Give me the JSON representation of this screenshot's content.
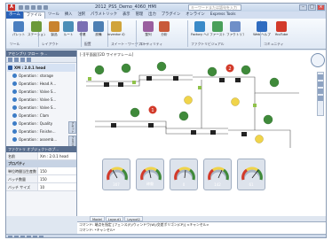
{
  "app": {
    "logo_text": "A",
    "title": "2012_PSS_Demo_4060_HMI",
    "search_placeholder": "キーワードまたは語句を入力"
  },
  "ribbon_tabs": [
    "ホーム",
    "ファイル",
    "ツール",
    "挿入",
    "注釈",
    "パラメトリック",
    "表示",
    "管理",
    "出力",
    "プラグイン",
    "オンライン",
    "Express Tools"
  ],
  "ribbon_buttons": [
    {
      "label": "パレット",
      "icon": "palette-icon",
      "color": "#4a7fc0"
    },
    {
      "label": "ステーション",
      "icon": "station-icon",
      "color": "#6c9a3a"
    },
    {
      "label": "製品",
      "icon": "product-icon",
      "color": "#c8832e"
    },
    {
      "label": "ルート",
      "icon": "route-icon",
      "color": "#4b8fb8"
    },
    {
      "label": "作業",
      "icon": "operation-icon",
      "color": "#7a6fb3"
    },
    {
      "label": "設備",
      "icon": "equipment-icon",
      "color": "#4d7fb3"
    },
    {
      "label": "Inventor の注記",
      "icon": "inventor-icon",
      "color": "#d0a43a"
    },
    {
      "label": "整列",
      "icon": "align-icon",
      "color": "#9a5f9f"
    },
    {
      "label": "分析",
      "icon": "analysis-icon",
      "color": "#c85a3a"
    },
    {
      "label": "Factory ヘルプ",
      "icon": "help-icon",
      "color": "#3a8ac8"
    },
    {
      "label": "ファースト",
      "icon": "first-icon",
      "color": "#4aa05a"
    },
    {
      "label": "ファクトリアセット",
      "icon": "asset-icon",
      "color": "#6f8fc8"
    },
    {
      "label": "Web ヘルプ",
      "icon": "web-help-icon",
      "color": "#2f6cc0"
    },
    {
      "label": "YouTube",
      "icon": "youtube-icon",
      "color": "#d23a2a"
    }
  ],
  "ribbon_panels": [
    "ツール",
    "レイアウト",
    "配置",
    "スイート・ワークフロー",
    "ユーティリティ",
    "ファクトリビジュアル",
    "コミュニティ"
  ],
  "left_panel": {
    "title": "アセンブリ フロー ラ…",
    "tree": [
      {
        "label": "XM : 2.0.1 head",
        "root": true
      },
      {
        "label": "Operation : storage"
      },
      {
        "label": "Operation : Head A…"
      },
      {
        "label": "Operation : Valve S…"
      },
      {
        "label": "Operation : Valve S…"
      },
      {
        "label": "Operation : Valve S…"
      },
      {
        "label": "Operation : Clam"
      },
      {
        "label": "Operation : Quality"
      },
      {
        "label": "Operation : Finishe…"
      },
      {
        "label": "Operation : assemb…"
      }
    ],
    "side_tabs": [
      "アセット",
      "プロパティ",
      "レイヤ"
    ]
  },
  "properties": {
    "title": "ファクトリ オブジェクトのプ…",
    "name_key": "名前",
    "name_value": "Xm : 2.0.1 head",
    "category": "プロパティ",
    "rows": [
      {
        "key": "単位時間当生産数",
        "value": "150"
      },
      {
        "key": "バッチ数量",
        "value": "150"
      },
      {
        "key": "バッチ サイズ",
        "value": "10"
      }
    ]
  },
  "viewport": {
    "label": "[-][平面図][2D ワイヤフレーム]",
    "markers": [
      "1",
      "2"
    ],
    "gauges": [
      {
        "value": "307",
        "label": "307"
      },
      {
        "value": "稼働",
        "label": "稼働"
      },
      {
        "value": "0",
        "label": "0"
      },
      {
        "value": "142",
        "label": "142"
      },
      {
        "value": "61",
        "label": "61"
      }
    ]
  },
  "model_tabs": [
    "Model",
    "Layout1",
    "Layout2"
  ],
  "command_lines": [
    "コマンド: 端点を指定 [フェンス(F)/ウィンドウ(W)/交差ポリゴン(CP)] <キャンセル>",
    "コマンド: *キャンセル*",
    "コマンド:"
  ],
  "colors": {
    "accent": "#2a62b8",
    "station_green": "#3f8a3a",
    "marker_red": "#d23a2a"
  }
}
